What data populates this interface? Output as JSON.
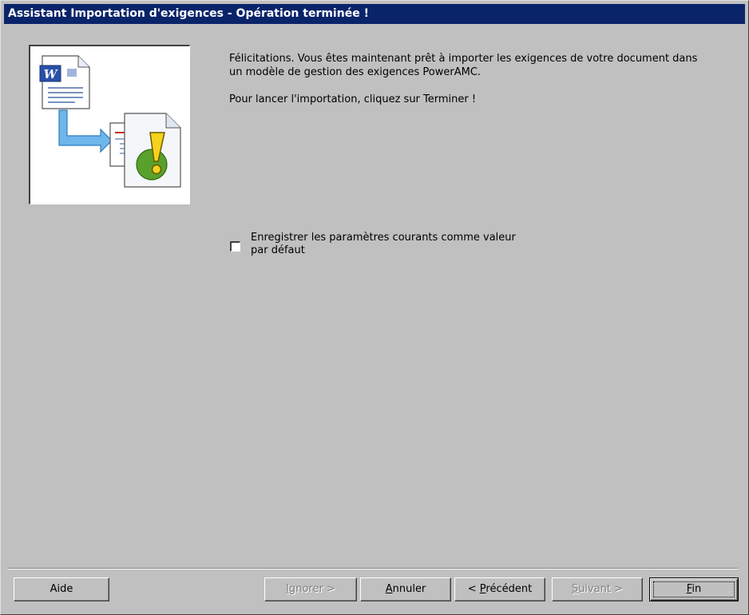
{
  "window": {
    "title": "Assistant Importation d'exigences - Opération terminée !"
  },
  "message": {
    "paragraph1": "Félicitations. Vous êtes maintenant prêt à importer les exigences de votre document dans un modèle de gestion des exigences PowerAMC.",
    "paragraph2": "Pour lancer l'importation, cliquez sur Terminer !"
  },
  "option": {
    "label": "Enregistrer les paramètres courants comme valeur par défaut",
    "checked": false
  },
  "buttons": {
    "help": "Aide",
    "skip": {
      "mnemonic": "I",
      "rest": "gnorer >"
    },
    "cancel": {
      "mnemonic": "A",
      "rest": "nnuler"
    },
    "back": {
      "pre": "< ",
      "mnemonic": "P",
      "rest": "récédent"
    },
    "next": {
      "mnemonic": "S",
      "rest": "uivant >"
    },
    "finish": {
      "mnemonic": "F",
      "rest": "in"
    }
  },
  "icons": [
    "word-document-icon",
    "arrow-icon",
    "requirements-document-icon",
    "warning-icon"
  ]
}
